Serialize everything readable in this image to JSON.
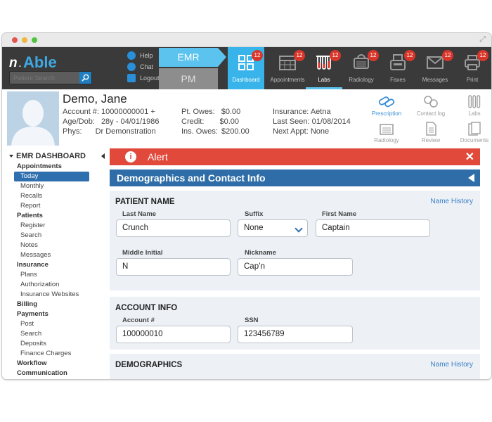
{
  "app": {
    "logo": "n Able"
  },
  "nav": {
    "search_placeholder": "Patient Search",
    "links": [
      "Help",
      "Chat",
      "Logout"
    ],
    "mode_tabs": {
      "emr": "EMR",
      "pm": "PM"
    },
    "items": [
      {
        "label": "Dashboard",
        "badge": "12",
        "icon": "dashboard-icon"
      },
      {
        "label": "Appointments",
        "badge": "12",
        "icon": "calendar-icon"
      },
      {
        "label": "Labs",
        "badge": "12",
        "icon": "test-tubes-icon"
      },
      {
        "label": "Radiology",
        "badge": "12",
        "icon": "radiology-icon"
      },
      {
        "label": "Faxes",
        "badge": "12",
        "icon": "fax-icon"
      },
      {
        "label": "Messages",
        "badge": "12",
        "icon": "envelope-icon"
      },
      {
        "label": "Print",
        "badge": "12",
        "icon": "printer-icon"
      }
    ]
  },
  "patient": {
    "name": "Demo, Jane",
    "account_label": "Account #:",
    "account_value": "10000000001 +",
    "age_label": "Age/Dob:",
    "age_value": "28y - 04/01/1986",
    "phys_label": "Phys:",
    "phys_value": "Dr Demonstration",
    "pt_owes_label": "Pt. Owes:",
    "pt_owes_value": "$0.00",
    "credit_label": "Credit:",
    "credit_value": "$0.00",
    "ins_owes_label": "Ins. Owes:",
    "ins_owes_value": "$200.00",
    "insurance_label": "Insurance:",
    "insurance_value": "Aetna",
    "last_seen_label": "Last Seen:",
    "last_seen_value": "01/08/2014",
    "next_appt_label": "Next Appt:",
    "next_appt_value": "None"
  },
  "quick_actions": [
    "Prescription",
    "Contact log",
    "Labs",
    "Radiology",
    "Review",
    "Documents"
  ],
  "sidebar": {
    "title": "EMR DASHBOARD",
    "sections": [
      {
        "label": "Appointments",
        "items": [
          "Today",
          "Monthly",
          "Recalls",
          "Report"
        ]
      },
      {
        "label": "Patients",
        "items": [
          "Register",
          "Search",
          "Notes",
          "Messages"
        ]
      },
      {
        "label": "Insurance",
        "items": [
          "Plans",
          "Authorization",
          "Insurance Websites"
        ]
      },
      {
        "label": "Billing",
        "items": []
      },
      {
        "label": "Payments",
        "items": [
          "Post",
          "Search",
          "Deposits",
          "Finance Charges"
        ]
      },
      {
        "label": "Workflow",
        "items": []
      },
      {
        "label": "Communication",
        "items": []
      }
    ]
  },
  "alert": {
    "text": "Alert",
    "close": "✕"
  },
  "section_title": "Demographics and Contact Info",
  "patient_name_panel": {
    "title": "PATIENT NAME",
    "link": "Name History",
    "last_name_label": "Last Name",
    "last_name": "Crunch",
    "suffix_label": "Suffix",
    "suffix": "None",
    "first_name_label": "First Name",
    "first_name": "Captain",
    "middle_label": "Middle Initial",
    "middle": "N",
    "nickname_label": "Nickname",
    "nickname": "Cap’n"
  },
  "account_panel": {
    "title": "ACCOUNT INFO",
    "account_label": "Account #",
    "account": "100000010",
    "ssn_label": "SSN",
    "ssn": "123456789"
  },
  "demographics_panel": {
    "title": "DEMOGRAPHICS",
    "link": "Name History"
  },
  "colors": {
    "accent": "#38b4ea",
    "alert": "#e1493b",
    "header_blue": "#2e6da7",
    "badge": "#d9362b"
  }
}
